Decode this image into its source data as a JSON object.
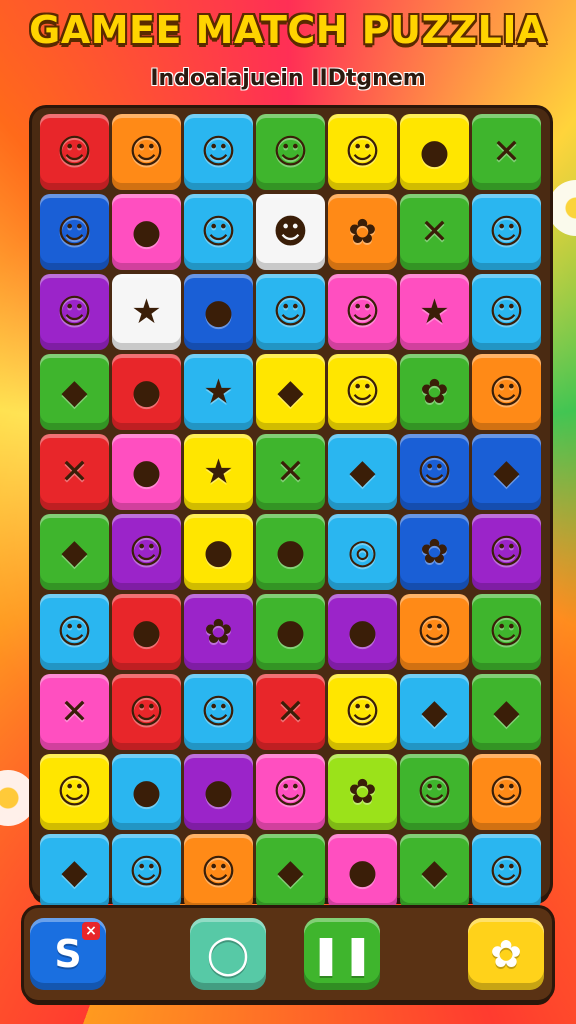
{
  "header": {
    "title": "GAMEE MATCH PUZZLIA",
    "subtitle": "Indoaiajuein IIDtgnem"
  },
  "board": {
    "rows": [
      [
        {
          "color": "red",
          "icon": "pink-creature-icon",
          "glyph": "☺"
        },
        {
          "color": "orange",
          "icon": "orange-bear-icon",
          "glyph": "☺"
        },
        {
          "color": "sky",
          "icon": "green-frog-icon",
          "glyph": "☺"
        },
        {
          "color": "green",
          "icon": "orange-cat-icon",
          "glyph": "☺"
        },
        {
          "color": "yellow",
          "icon": "blue-bear-icon",
          "glyph": "☺"
        },
        {
          "color": "yellow",
          "icon": "orange-fruit-icon",
          "glyph": "●"
        },
        {
          "color": "green",
          "icon": "cherry-stick-icon",
          "glyph": "✕"
        }
      ],
      [
        {
          "color": "blue",
          "icon": "hamster-icon",
          "glyph": "☺"
        },
        {
          "color": "pink",
          "icon": "yellow-lemon-icon",
          "glyph": "●"
        },
        {
          "color": "sky",
          "icon": "orange-fox-icon",
          "glyph": "☺"
        },
        {
          "color": "white",
          "icon": "red-bird-icon",
          "glyph": "☻"
        },
        {
          "color": "orange",
          "icon": "blue-flower-icon",
          "glyph": "✿"
        },
        {
          "color": "green",
          "icon": "crossed-sticks-icon",
          "glyph": "✕"
        },
        {
          "color": "sky",
          "icon": "red-hat-face-icon",
          "glyph": "☺"
        }
      ],
      [
        {
          "color": "purple",
          "icon": "pink-pig-icon",
          "glyph": "☺"
        },
        {
          "color": "white",
          "icon": "yellow-star-fruit-icon",
          "glyph": "★"
        },
        {
          "color": "blue",
          "icon": "green-apple-icon",
          "glyph": "●"
        },
        {
          "color": "sky",
          "icon": "orange-cat-icon",
          "glyph": "☺"
        },
        {
          "color": "pink",
          "icon": "blue-bear-icon",
          "glyph": "☺"
        },
        {
          "color": "pink",
          "icon": "blue-star-icon",
          "glyph": "★"
        },
        {
          "color": "sky",
          "icon": "cream-cat-icon",
          "glyph": "☺"
        }
      ],
      [
        {
          "color": "green",
          "icon": "orange-fish-icon",
          "glyph": "◆"
        },
        {
          "color": "red",
          "icon": "purple-berry-icon",
          "glyph": "●"
        },
        {
          "color": "sky",
          "icon": "yellow-star-icon",
          "glyph": "★"
        },
        {
          "color": "yellow",
          "icon": "blue-carrot-icon",
          "glyph": "◆"
        },
        {
          "color": "yellow",
          "icon": "orange-balloon-icon",
          "glyph": "☺"
        },
        {
          "color": "green",
          "icon": "purple-grapes-icon",
          "glyph": "✿"
        },
        {
          "color": "orange",
          "icon": "red-hat-face-icon",
          "glyph": "☺"
        }
      ],
      [
        {
          "color": "red",
          "icon": "candy-icon",
          "glyph": "✕"
        },
        {
          "color": "pink",
          "icon": "blue-fish-icon",
          "glyph": "●"
        },
        {
          "color": "yellow",
          "icon": "blue-star-icon",
          "glyph": "★"
        },
        {
          "color": "green",
          "icon": "red-sticks-icon",
          "glyph": "✕"
        },
        {
          "color": "sky",
          "icon": "green-leaf-icon",
          "glyph": "◆"
        },
        {
          "color": "blue",
          "icon": "yellow-bunny-icon",
          "glyph": "☺"
        },
        {
          "color": "blue",
          "icon": "yellow-bird-icon",
          "glyph": "◆"
        }
      ],
      [
        {
          "color": "green",
          "icon": "green-pea-icon",
          "glyph": "◆"
        },
        {
          "color": "purple",
          "icon": "yellow-chick-icon",
          "glyph": "☺"
        },
        {
          "color": "yellow",
          "icon": "purple-bug-icon",
          "glyph": "●"
        },
        {
          "color": "green",
          "icon": "purple-candy-icon",
          "glyph": "●"
        },
        {
          "color": "sky",
          "icon": "ring-icon",
          "glyph": "◎"
        },
        {
          "color": "blue",
          "icon": "orange-flower-icon",
          "glyph": "✿"
        },
        {
          "color": "purple",
          "icon": "green-alien-icon",
          "glyph": "☺"
        }
      ],
      [
        {
          "color": "sky",
          "icon": "purple-bat-icon",
          "glyph": "☺"
        },
        {
          "color": "red",
          "icon": "white-ghost-icon",
          "glyph": "●"
        },
        {
          "color": "purple",
          "icon": "yellow-flower-icon",
          "glyph": "✿"
        },
        {
          "color": "green",
          "icon": "green-ball-icon",
          "glyph": "●"
        },
        {
          "color": "purple",
          "icon": "green-apple-icon",
          "glyph": "●"
        },
        {
          "color": "orange",
          "icon": "white-face-icon",
          "glyph": "☺"
        },
        {
          "color": "green",
          "icon": "red-hat-face-icon",
          "glyph": "☺"
        }
      ],
      [
        {
          "color": "pink",
          "icon": "blue-candy-icon",
          "glyph": "✕"
        },
        {
          "color": "red",
          "icon": "green-apple-icon",
          "glyph": "☺"
        },
        {
          "color": "sky",
          "icon": "yellow-fox-icon",
          "glyph": "☺"
        },
        {
          "color": "red",
          "icon": "green-candy-icon",
          "glyph": "✕"
        },
        {
          "color": "yellow",
          "icon": "orange-face-icon",
          "glyph": "☺"
        },
        {
          "color": "sky",
          "icon": "yellow-bell-icon",
          "glyph": "◆"
        },
        {
          "color": "green",
          "icon": "green-kite-icon",
          "glyph": "◆"
        }
      ],
      [
        {
          "color": "yellow",
          "icon": "blue-bear-icon",
          "glyph": "☺"
        },
        {
          "color": "sky",
          "icon": "purple-plum-icon",
          "glyph": "●"
        },
        {
          "color": "purple",
          "icon": "lollipop-icon",
          "glyph": "●"
        },
        {
          "color": "pink",
          "icon": "brown-bear-icon",
          "glyph": "☺"
        },
        {
          "color": "lime",
          "icon": "blue-cloud-icon",
          "glyph": "✿"
        },
        {
          "color": "green",
          "icon": "white-rabbit-icon",
          "glyph": "☺"
        },
        {
          "color": "orange",
          "icon": "pink-bear-icon",
          "glyph": "☺"
        }
      ],
      [
        {
          "color": "sky",
          "icon": "pink-radish-icon",
          "glyph": "◆"
        },
        {
          "color": "sky",
          "icon": "green-frog-icon",
          "glyph": "☺"
        },
        {
          "color": "orange",
          "icon": "orange-bear-icon",
          "glyph": "☺"
        },
        {
          "color": "green",
          "icon": "white-kite-icon",
          "glyph": "◆"
        },
        {
          "color": "pink",
          "icon": "orange-lollipop-icon",
          "glyph": "●"
        },
        {
          "color": "green",
          "icon": "red-bowl-icon",
          "glyph": "◆"
        },
        {
          "color": "sky",
          "icon": "orange-fox-icon",
          "glyph": "☺"
        }
      ]
    ]
  },
  "controls": [
    {
      "name": "shuffle-button",
      "icon": "s-swap-icon",
      "glyph": "S",
      "color": "#1a6fe0",
      "badge": "×"
    },
    {
      "name": "hint-button",
      "icon": "speech-bubble-icon",
      "glyph": "◯",
      "color": "#57c9a6"
    },
    {
      "name": "pause-button",
      "icon": "pause-icon",
      "glyph": "❚❚",
      "color": "#3fb52d"
    },
    {
      "name": "settings-button",
      "icon": "flower-icon",
      "glyph": "✿",
      "color": "#ffd21a"
    }
  ],
  "palette": {
    "red": "#e8262a",
    "orange": "#ff8a17",
    "yellow": "#ffe600",
    "green": "#3fb52d",
    "lime": "#9be21a",
    "sky": "#2ab6f0",
    "blue": "#1a5fd6",
    "pink": "#ff4fc0",
    "purple": "#9b24c9",
    "white": "#f6f6f6"
  }
}
